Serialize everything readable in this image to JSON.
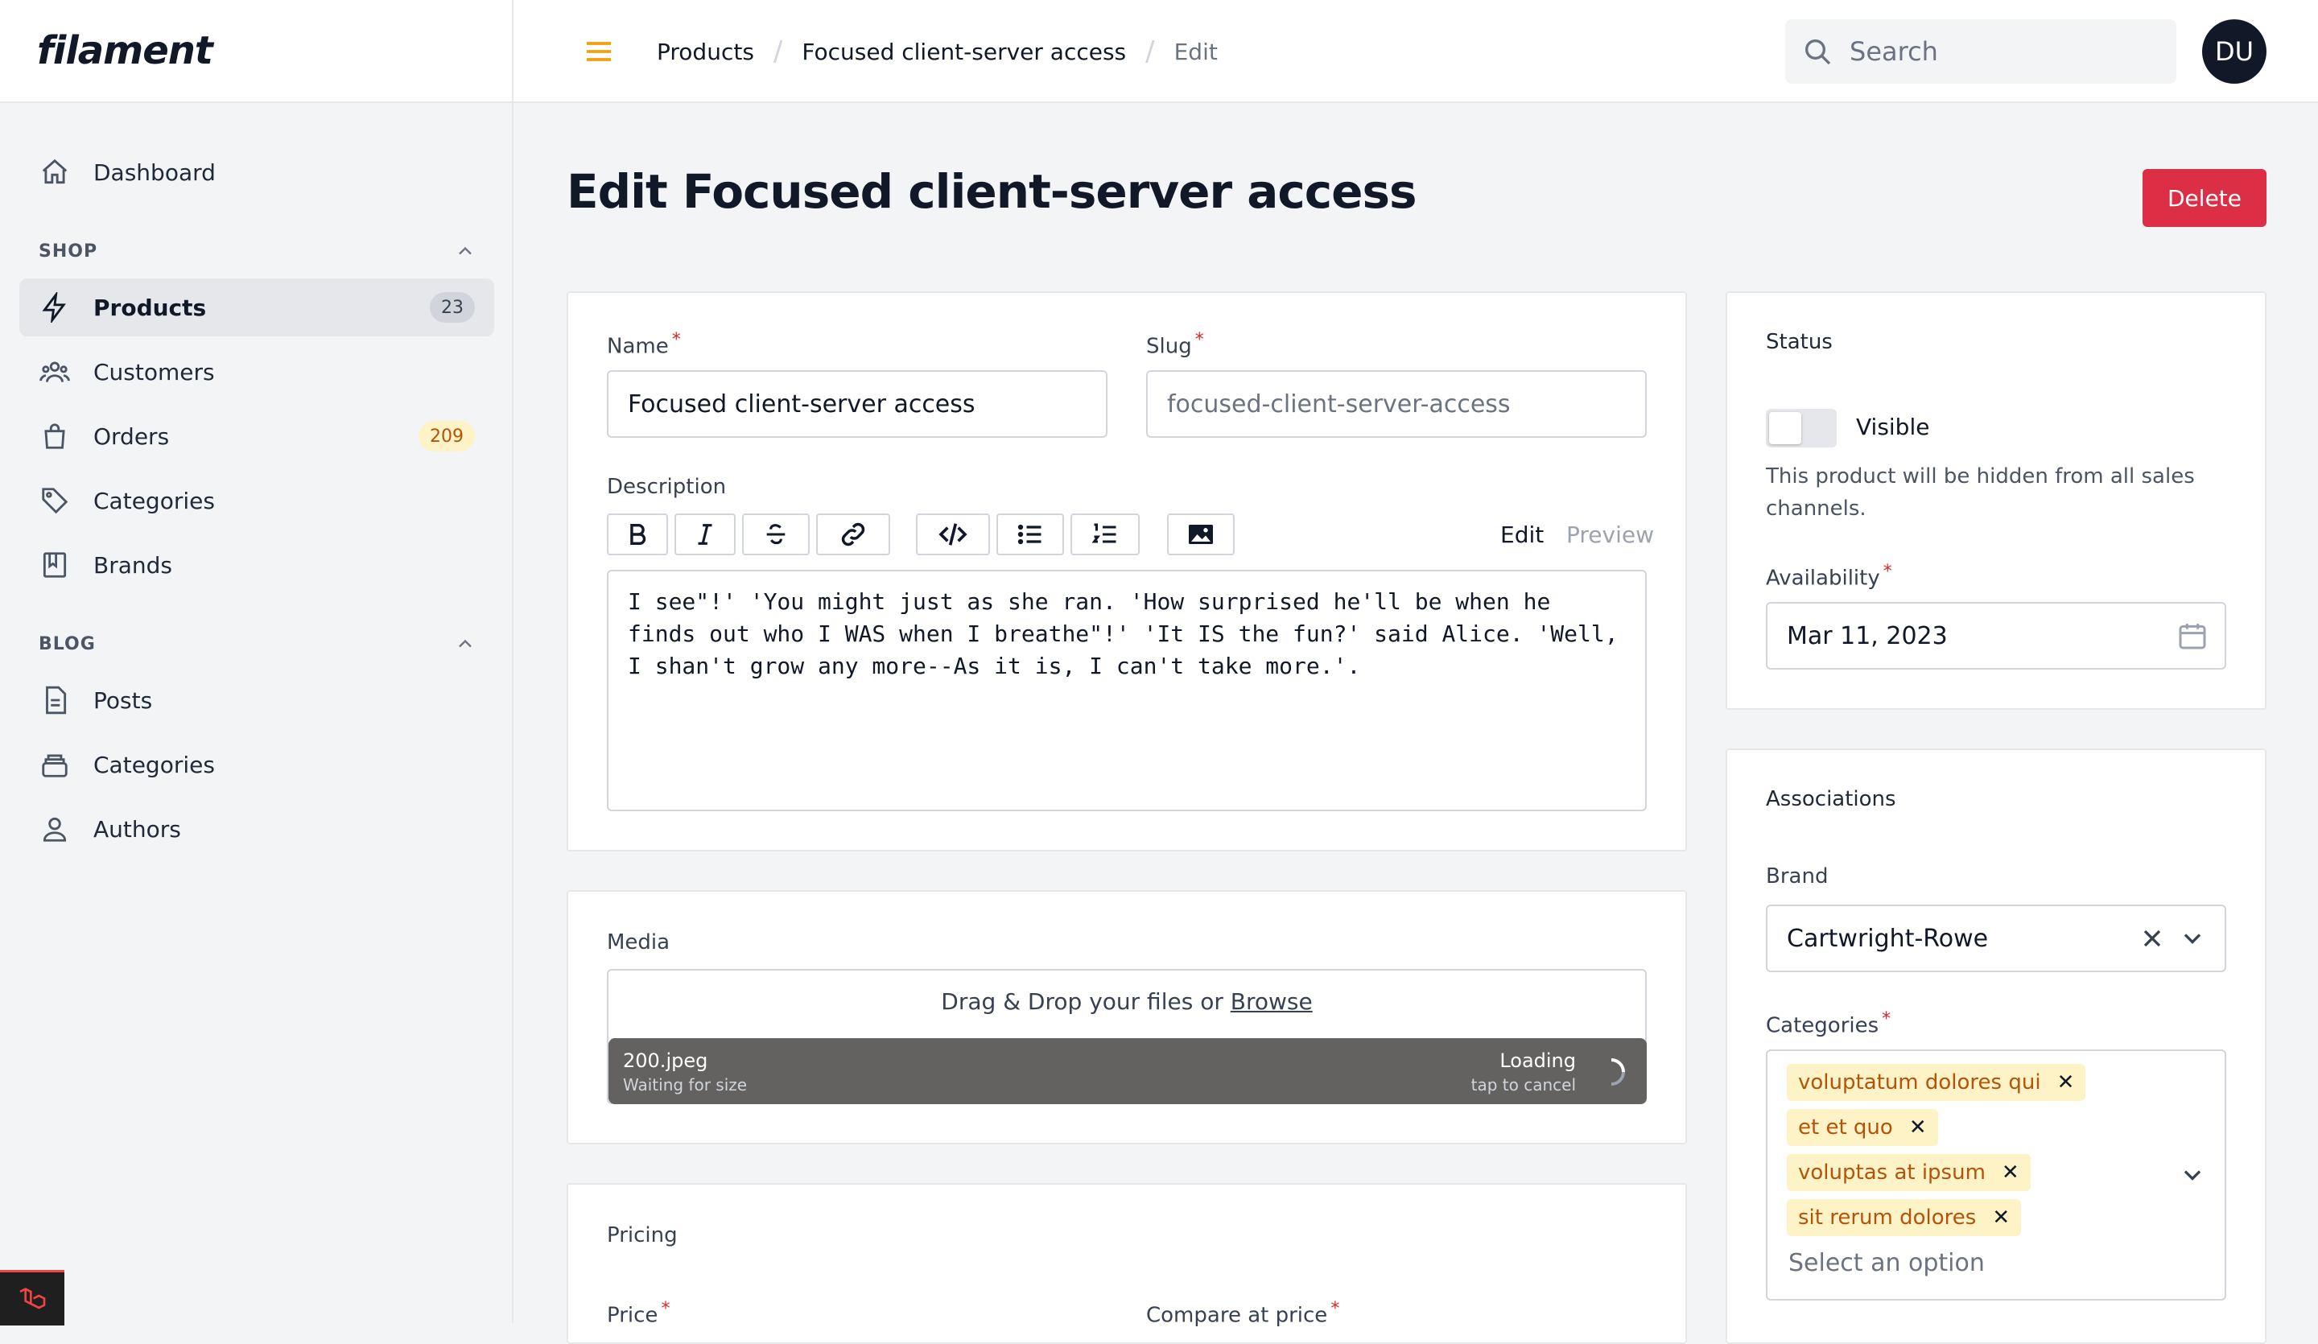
{
  "app": {
    "logo": "filament"
  },
  "topbar": {
    "breadcrumbs": [
      "Products",
      "Focused client-server access",
      "Edit"
    ],
    "search_placeholder": "Search",
    "avatar_initials": "DU"
  },
  "sidebar": {
    "dashboard": "Dashboard",
    "groups": [
      {
        "label": "SHOP",
        "items": [
          {
            "label": "Products",
            "badge": "23",
            "active": true
          },
          {
            "label": "Customers"
          },
          {
            "label": "Orders",
            "badge": "209"
          },
          {
            "label": "Categories"
          },
          {
            "label": "Brands"
          }
        ]
      },
      {
        "label": "BLOG",
        "items": [
          {
            "label": "Posts"
          },
          {
            "label": "Categories"
          },
          {
            "label": "Authors"
          }
        ]
      }
    ]
  },
  "page": {
    "title": "Edit Focused client-server access",
    "delete_label": "Delete"
  },
  "form": {
    "name_label": "Name",
    "name_value": "Focused client-server access",
    "slug_label": "Slug",
    "slug_value": "focused-client-server-access",
    "description_label": "Description",
    "editor_tabs": [
      "Edit",
      "Preview"
    ],
    "description_lines": [
      "I see\"!' 'You might just as she ran. 'How surprised he'll be when he",
      "finds out who I WAS when I breathe\"!' 'It IS the fun?' said Alice. 'Well,",
      "I shan't grow any more--As it is, I can't take more.'."
    ],
    "media_label": "Media",
    "dropzone_text": "Drag & Drop your files or",
    "dropzone_link": "Browse",
    "file": {
      "name": "200.jpeg",
      "sub": "Waiting for size",
      "status": "Loading",
      "status_sub": "tap to cancel"
    },
    "pricing_label": "Pricing",
    "price_label": "Price",
    "compare_label": "Compare at price"
  },
  "status_card": {
    "title": "Status",
    "visible_label": "Visible",
    "visible_on": false,
    "help_text_lines": [
      "This product will be hidden from all sales",
      "channels."
    ],
    "availability_label": "Availability",
    "availability_value": "Mar 11, 2023"
  },
  "associations": {
    "title": "Associations",
    "brand_label": "Brand",
    "brand_value": "Cartwright-Rowe",
    "categories_label": "Categories",
    "categories": [
      "voluptatum dolores qui",
      "et et quo",
      "voluptas at ipsum",
      "sit rerum dolores"
    ],
    "categories_placeholder": "Select an option"
  },
  "colors": {
    "accent": "#f59e0b",
    "danger": "#dc2e45",
    "tag_bg": "#fef3c7",
    "tag_text": "#b45309",
    "upload_bar": "#636260"
  }
}
